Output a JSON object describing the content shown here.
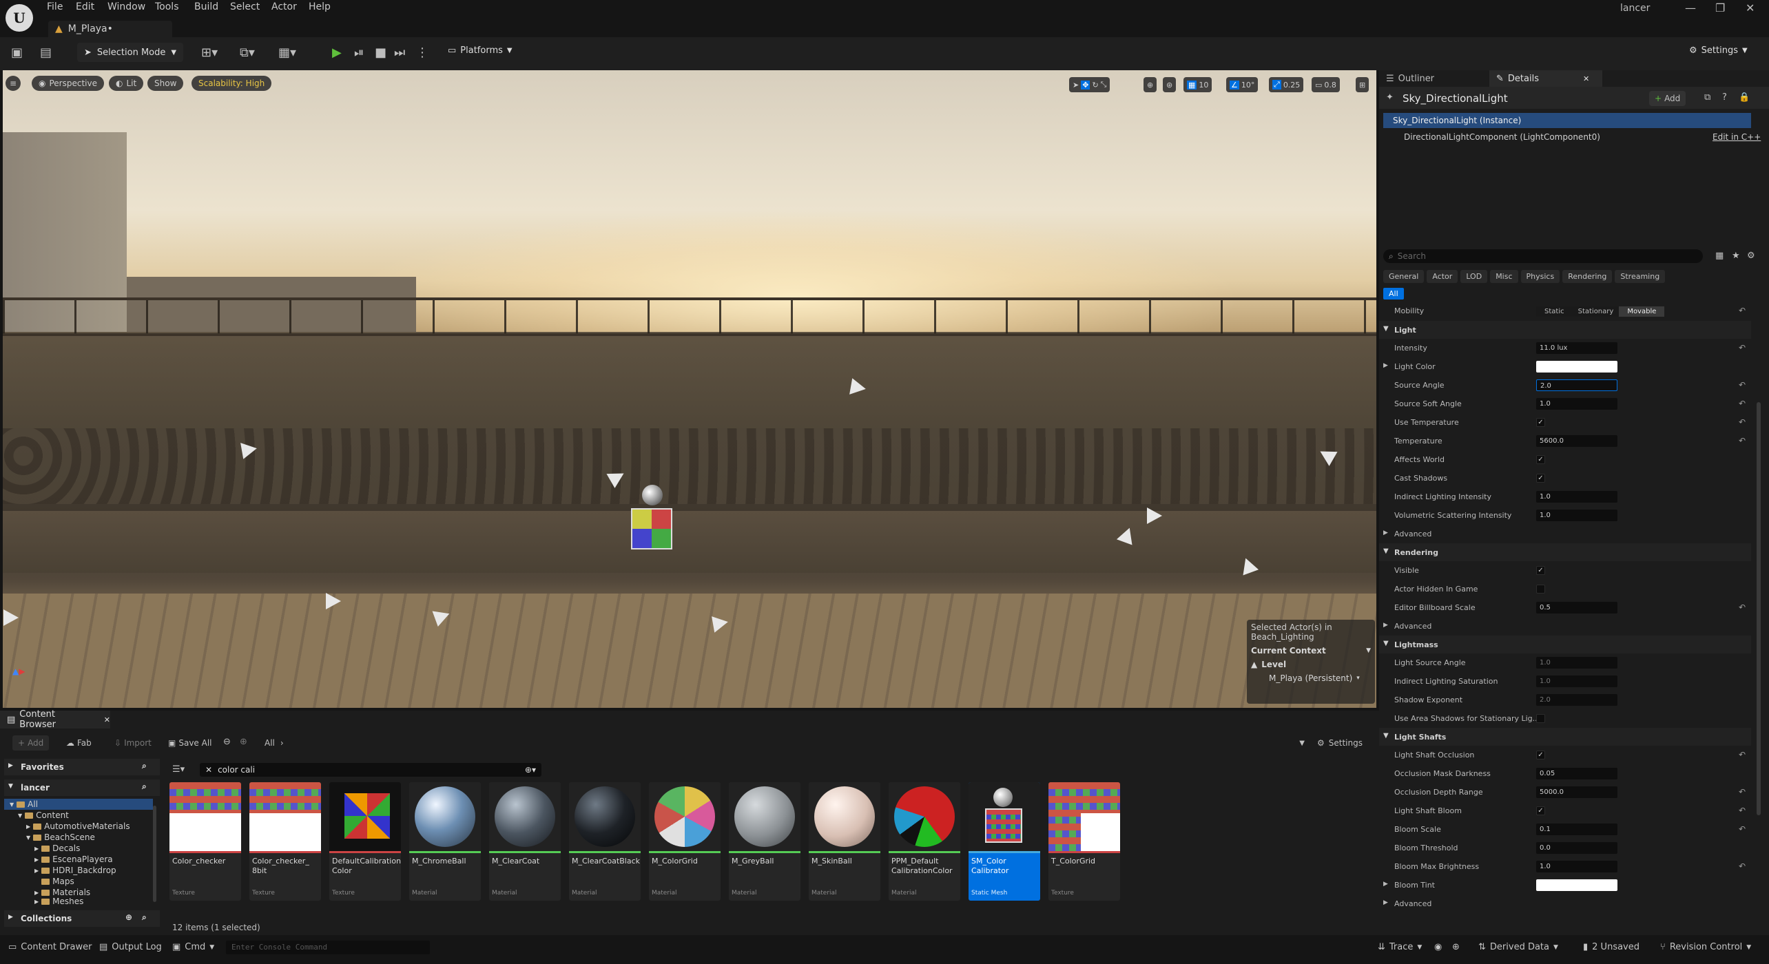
{
  "menu": {
    "items": [
      "File",
      "Edit",
      "Window",
      "Tools",
      "Build",
      "Select",
      "Actor",
      "Help"
    ],
    "user": "lancer",
    "level_tab": "M_Playa•"
  },
  "toolbar": {
    "selection_mode": "Selection Mode",
    "platforms": "Platforms",
    "settings": "Settings"
  },
  "viewport": {
    "perspective": "Perspective",
    "lit": "Lit",
    "show": "Show",
    "scalability": "Scalability: High",
    "grid_size": "10",
    "rot_snap": "10°",
    "scale_snap": "0.25",
    "cam_speed": "0.8",
    "selected_info": "Selected Actor(s) in",
    "selected_level": "Beach_Lighting",
    "current_context": "Current Context",
    "level_label": "Level",
    "level_value": "M_Playa (Persistent)"
  },
  "outliner": {
    "tab_outliner": "Outliner",
    "tab_details": "Details",
    "actor_name": "Sky_DirectionalLight",
    "add": "Add",
    "instance": "Sky_DirectionalLight (Instance)",
    "component": "DirectionalLightComponent (LightComponent0)",
    "edit_cpp": "Edit in C++",
    "search_placeholder": "Search",
    "filters": [
      "General",
      "Actor",
      "LOD",
      "Misc",
      "Physics",
      "Rendering",
      "Streaming"
    ],
    "filter_all": "All"
  },
  "details": {
    "mobility_label": "Mobility",
    "mobility": [
      "Static",
      "Stationary",
      "Movable"
    ],
    "light_section": "Light",
    "intensity_label": "Intensity",
    "intensity": "11.0 lux",
    "light_color_label": "Light Color",
    "source_angle_label": "Source Angle",
    "source_angle": "2.0",
    "source_soft_angle_label": "Source Soft Angle",
    "source_soft_angle": "1.0",
    "use_temperature_label": "Use Temperature",
    "temperature_label": "Temperature",
    "temperature": "5600.0",
    "affects_world_label": "Affects World",
    "cast_shadows_label": "Cast Shadows",
    "indirect_label": "Indirect Lighting Intensity",
    "indirect": "1.0",
    "volumetric_label": "Volumetric Scattering Intensity",
    "volumetric": "1.0",
    "advanced": "Advanced",
    "rendering_section": "Rendering",
    "visible_label": "Visible",
    "hidden_label": "Actor Hidden In Game",
    "billboard_label": "Editor Billboard Scale",
    "billboard": "0.5",
    "lightmass_section": "Lightmass",
    "light_source_angle_label": "Light Source Angle",
    "light_source_angle": "1.0",
    "indirect_sat_label": "Indirect Lighting Saturation",
    "indirect_sat": "1.0",
    "shadow_exp_label": "Shadow Exponent",
    "shadow_exp": "2.0",
    "area_shadows_label": "Use Area Shadows for Stationary Lig...",
    "lightshafts_section": "Light Shafts",
    "occlusion_label": "Light Shaft Occlusion",
    "mask_dark_label": "Occlusion Mask Darkness",
    "mask_dark": "0.05",
    "depth_range_label": "Occlusion Depth Range",
    "depth_range": "5000.0",
    "bloom_label": "Light Shaft Bloom",
    "bloom_scale_label": "Bloom Scale",
    "bloom_scale": "0.1",
    "bloom_thresh_label": "Bloom Threshold",
    "bloom_thresh": "0.0",
    "bloom_max_label": "Bloom Max Brightness",
    "bloom_max": "1.0",
    "bloom_tint_label": "Bloom Tint"
  },
  "content_browser": {
    "tab": "Content Browser",
    "add": "Add",
    "fab": "Fab",
    "import": "Import",
    "save_all": "Save All",
    "path_all": "All",
    "settings": "Settings",
    "favorites": "Favorites",
    "root": "lancer",
    "tree": [
      "All",
      "Content",
      "AutomotiveMaterials",
      "BeachScene",
      "Decals",
      "EscenaPlayera",
      "HDRI_Backdrop",
      "Maps",
      "Materials",
      "Meshes"
    ],
    "collections": "Collections",
    "search_value": "color cali",
    "items_count": "12 items (1 selected)",
    "assets": [
      {
        "name": "Color_checker",
        "type": "Texture"
      },
      {
        "name": "Color_checker_ 8bit",
        "type": "Texture"
      },
      {
        "name": "DefaultCalibration Color",
        "type": "Texture"
      },
      {
        "name": "M_ChromeBall",
        "type": "Material"
      },
      {
        "name": "M_ClearCoat",
        "type": "Material"
      },
      {
        "name": "M_ClearCoatBlack",
        "type": "Material"
      },
      {
        "name": "M_ColorGrid",
        "type": "Material"
      },
      {
        "name": "M_GreyBall",
        "type": "Material"
      },
      {
        "name": "M_SkinBall",
        "type": "Material"
      },
      {
        "name": "PPM_Default CalibrationColor",
        "type": "Material"
      },
      {
        "name": "SM_Color Calibrator",
        "type": "Static Mesh"
      },
      {
        "name": "T_ColorGrid",
        "type": "Texture"
      }
    ]
  },
  "statusbar": {
    "content_drawer": "Content Drawer",
    "output_log": "Output Log",
    "cmd": "Cmd",
    "console_placeholder": "Enter Console Command",
    "trace": "Trace",
    "derived_data": "Derived Data",
    "unsaved": "2 Unsaved",
    "revision": "Revision Control"
  },
  "colors": {
    "accent": "#0070e0",
    "selection": "#264b7d",
    "play_green": "#5fbf3c",
    "scalability_yellow": "#e8c544"
  }
}
